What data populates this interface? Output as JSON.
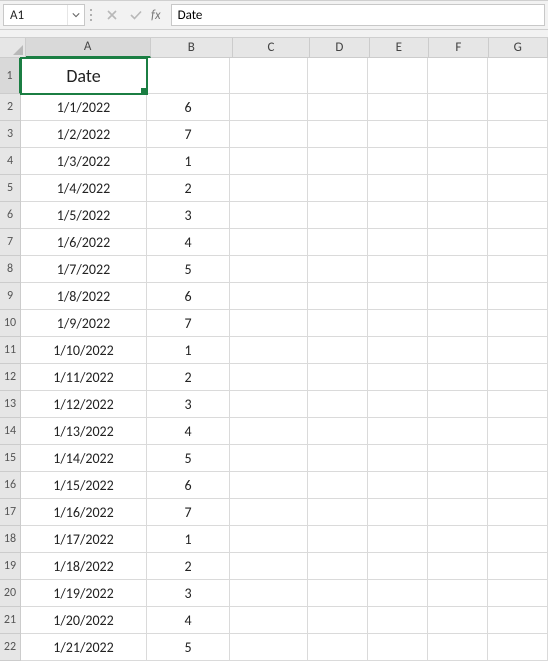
{
  "nameBox": {
    "value": "A1"
  },
  "formulaBar": {
    "value": "Date",
    "fxLabel": "fx"
  },
  "columns": [
    "A",
    "B",
    "C",
    "D",
    "E",
    "F",
    "G"
  ],
  "activeCell": {
    "row": 1,
    "col": "A"
  },
  "rows": [
    {
      "n": 1,
      "A": "Date",
      "B": ""
    },
    {
      "n": 2,
      "A": "1/1/2022",
      "B": "6"
    },
    {
      "n": 3,
      "A": "1/2/2022",
      "B": "7"
    },
    {
      "n": 4,
      "A": "1/3/2022",
      "B": "1"
    },
    {
      "n": 5,
      "A": "1/4/2022",
      "B": "2"
    },
    {
      "n": 6,
      "A": "1/5/2022",
      "B": "3"
    },
    {
      "n": 7,
      "A": "1/6/2022",
      "B": "4"
    },
    {
      "n": 8,
      "A": "1/7/2022",
      "B": "5"
    },
    {
      "n": 9,
      "A": "1/8/2022",
      "B": "6"
    },
    {
      "n": 10,
      "A": "1/9/2022",
      "B": "7"
    },
    {
      "n": 11,
      "A": "1/10/2022",
      "B": "1"
    },
    {
      "n": 12,
      "A": "1/11/2022",
      "B": "2"
    },
    {
      "n": 13,
      "A": "1/12/2022",
      "B": "3"
    },
    {
      "n": 14,
      "A": "1/13/2022",
      "B": "4"
    },
    {
      "n": 15,
      "A": "1/14/2022",
      "B": "5"
    },
    {
      "n": 16,
      "A": "1/15/2022",
      "B": "6"
    },
    {
      "n": 17,
      "A": "1/16/2022",
      "B": "7"
    },
    {
      "n": 18,
      "A": "1/17/2022",
      "B": "1"
    },
    {
      "n": 19,
      "A": "1/18/2022",
      "B": "2"
    },
    {
      "n": 20,
      "A": "1/19/2022",
      "B": "3"
    },
    {
      "n": 21,
      "A": "1/20/2022",
      "B": "4"
    },
    {
      "n": 22,
      "A": "1/21/2022",
      "B": "5"
    }
  ]
}
